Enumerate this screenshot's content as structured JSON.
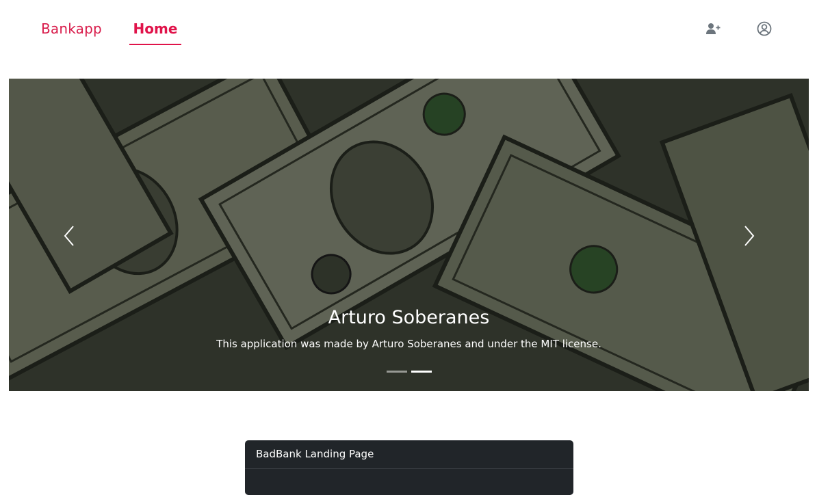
{
  "navbar": {
    "brand": "Bankapp",
    "links": [
      {
        "label": "Home",
        "active": true
      }
    ],
    "icons": [
      "add-user-icon",
      "user-circle-icon"
    ],
    "accent_color": "#e0134a"
  },
  "carousel": {
    "slide_title": "Arturo Soberanes",
    "slide_text": "This application was made by Arturo Soberanes and under the MIT license.",
    "slide_count": 2,
    "active_slide": 2,
    "controls": [
      "chevron-left-icon",
      "chevron-right-icon"
    ]
  },
  "card": {
    "title": "BadBank Landing Page"
  }
}
